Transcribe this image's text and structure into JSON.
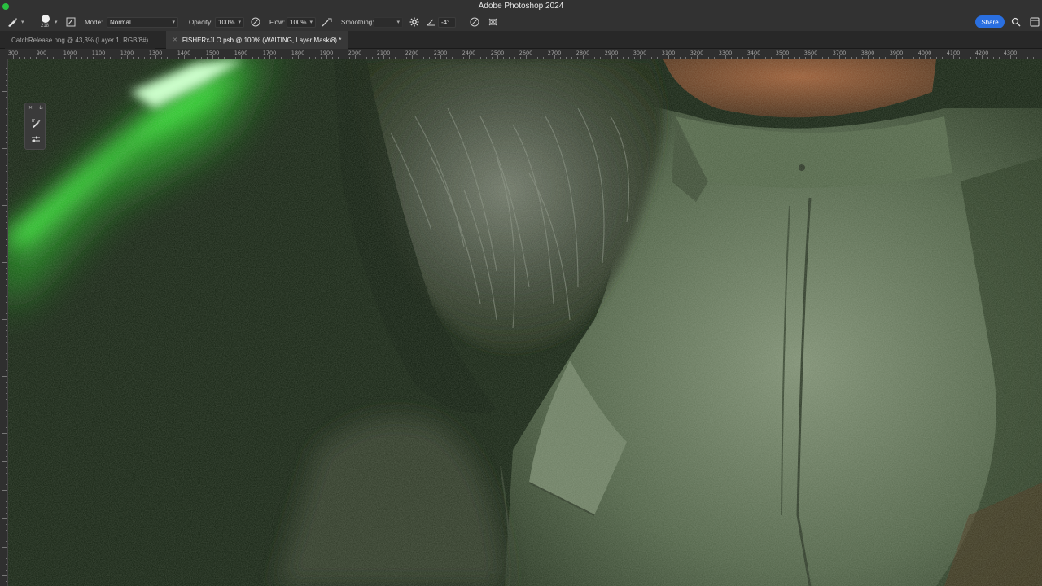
{
  "app": {
    "title": "Adobe Photoshop 2024"
  },
  "options_bar": {
    "brush_size": "218",
    "mode_label": "Mode:",
    "mode_value": "Normal",
    "opacity_label": "Opacity:",
    "opacity_value": "100%",
    "flow_label": "Flow:",
    "flow_value": "100%",
    "smoothing_label": "Smoothing:",
    "angle_value": "-4°",
    "share_label": "Share"
  },
  "tabs": [
    {
      "label": "CatchRelease.png @ 43,3% (Layer 1, RGB/8#)",
      "active": false
    },
    {
      "label": "FISHERxJLO.psb @ 100% (WAITING, Layer Mask/8) *",
      "active": true
    }
  ],
  "ruler": {
    "top_labels": [
      "300",
      "900",
      "1000",
      "1100",
      "1200",
      "1300",
      "1400",
      "1500",
      "1600",
      "1700",
      "1800",
      "1900",
      "2000",
      "2100",
      "2200",
      "2300",
      "2400",
      "2500",
      "2600",
      "2700",
      "2800",
      "2900",
      "3000",
      "3100",
      "3200",
      "3300",
      "3400",
      "3500",
      "3600",
      "3700",
      "3800",
      "3900",
      "4000",
      "4100",
      "4200",
      "4300"
    ]
  },
  "colors": {
    "accent": "#2a6fe0",
    "canvas_dark": "#152212",
    "neon_green": "#3cff3c",
    "skin": "#8a4a2a",
    "denim": "#5f7257"
  },
  "icons": {
    "brush": "brush-icon",
    "brush_preset": "brush-preset-icon",
    "airbrush": "airbrush-icon",
    "gear": "gear-icon",
    "angle": "angle-icon",
    "pressure": "pressure-icon",
    "symmetry": "symmetry-icon",
    "search": "search-icon",
    "workspace": "workspace-icon"
  }
}
